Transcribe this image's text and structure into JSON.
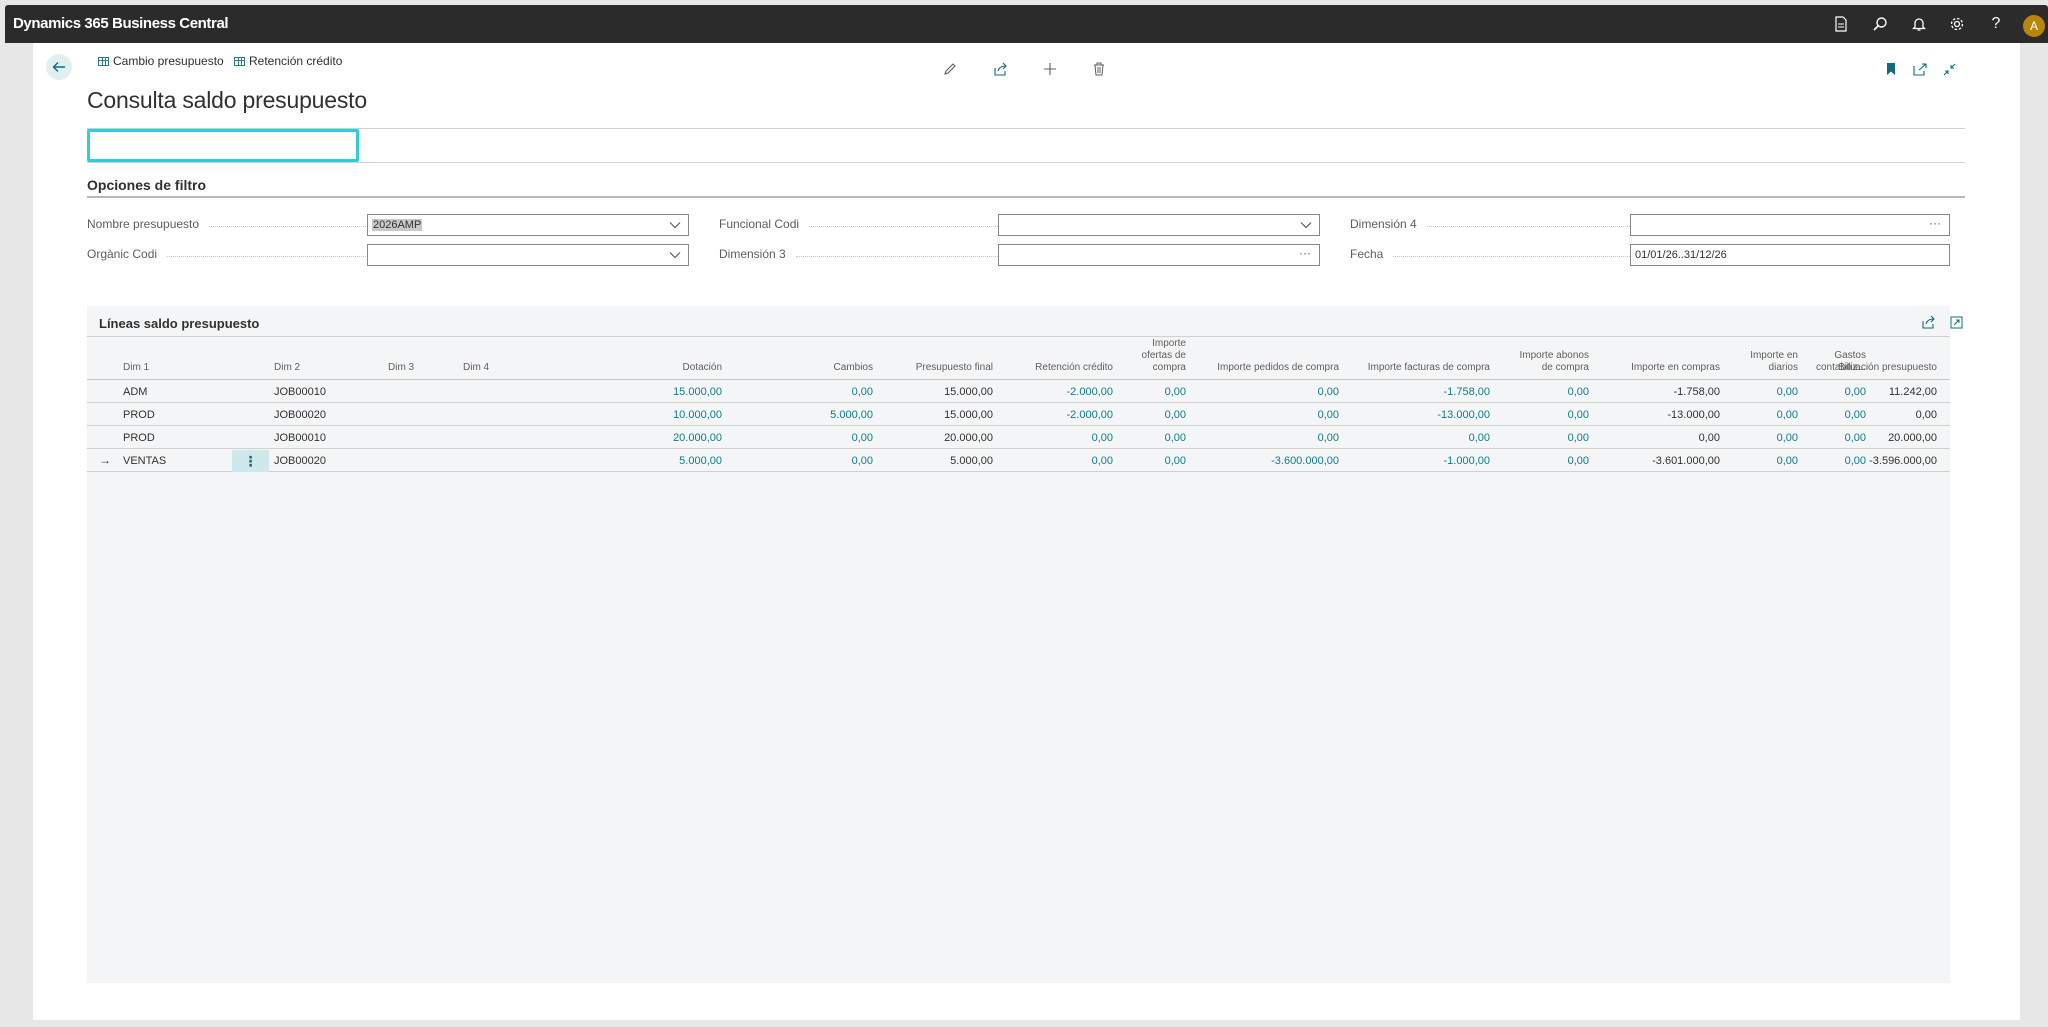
{
  "app": {
    "title": "Dynamics 365 Business Central",
    "user_initial": "A"
  },
  "topbar_icons": [
    "document-icon",
    "search-icon",
    "bell-icon",
    "gear-icon",
    "help-icon"
  ],
  "page": {
    "title": "Consulta saldo presupuesto",
    "actions": {
      "cambio": "Cambio presupuesto",
      "retencion": "Retención crédito"
    }
  },
  "filters": {
    "section_title": "Opciones de filtro",
    "nombre_label": "Nombre presupuesto",
    "nombre_value": "2026AMP",
    "organic_label": "Orgànic Codi",
    "organic_value": "",
    "funcional_label": "Funcional Codi",
    "funcional_value": "",
    "dim3_label": "Dimensión 3",
    "dim3_value": "",
    "dim4_label": "Dimensión 4",
    "dim4_value": "",
    "fecha_label": "Fecha",
    "fecha_value": "01/01/26..31/12/26",
    "more_glyph": "···"
  },
  "lines": {
    "title": "Líneas saldo presupuesto",
    "columns": {
      "dim1": "Dim 1",
      "dim2": "Dim 2",
      "dim3": "Dim 3",
      "dim4": "Dim 4",
      "dotacion": "Dotación",
      "cambios": "Cambios",
      "presupuesto_final": "Presupuesto final",
      "retencion": "Retención crédito",
      "ofertas_1": "Importe",
      "ofertas_2": "ofertas de",
      "ofertas_3": "compra",
      "pedidos": "Importe pedidos de compra",
      "facturas": "Importe facturas de compra",
      "abonos_1": "Importe abonos",
      "abonos_2": "de compra",
      "en_compras": "Importe en compras",
      "diarios_1": "Importe en",
      "diarios_2": "diarios",
      "gastos_1": "Gastos",
      "gastos_2": "contabiliz...",
      "situacion": "Situación presupuesto"
    },
    "rows": [
      {
        "dim1": "ADM",
        "dim2": "JOB00010",
        "dotacion": "15.000,00",
        "cambios": "0,00",
        "final": "15.000,00",
        "retencion": "-2.000,00",
        "ofertas": "0,00",
        "pedidos": "0,00",
        "facturas": "-1.758,00",
        "abonos": "0,00",
        "compras": "-1.758,00",
        "diarios": "0,00",
        "gastos": "0,00",
        "situacion": "11.242,00"
      },
      {
        "dim1": "PROD",
        "dim2": "JOB00020",
        "dotacion": "10.000,00",
        "cambios": "5.000,00",
        "final": "15.000,00",
        "retencion": "-2.000,00",
        "ofertas": "0,00",
        "pedidos": "0,00",
        "facturas": "-13.000,00",
        "abonos": "0,00",
        "compras": "-13.000,00",
        "diarios": "0,00",
        "gastos": "0,00",
        "situacion": "0,00"
      },
      {
        "dim1": "PROD",
        "dim2": "JOB00010",
        "dotacion": "20.000,00",
        "cambios": "0,00",
        "final": "20.000,00",
        "retencion": "0,00",
        "ofertas": "0,00",
        "pedidos": "0,00",
        "facturas": "0,00",
        "abonos": "0,00",
        "compras": "0,00",
        "diarios": "0,00",
        "gastos": "0,00",
        "situacion": "20.000,00"
      },
      {
        "dim1": "VENTAS",
        "dim2": "JOB00020",
        "dotacion": "5.000,00",
        "cambios": "0,00",
        "final": "5.000,00",
        "retencion": "0,00",
        "ofertas": "0,00",
        "pedidos": "-3.600.000,00",
        "facturas": "-1.000,00",
        "abonos": "0,00",
        "compras": "-3.601.000,00",
        "diarios": "0,00",
        "gastos": "0,00",
        "situacion": "-3.596.000,00"
      }
    ],
    "current_row_marker": "→",
    "row_menu_glyph": "⋮"
  }
}
